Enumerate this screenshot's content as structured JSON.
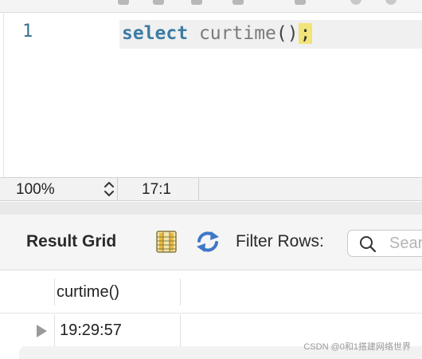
{
  "editor": {
    "line_number": "1",
    "code": {
      "keyword": "select",
      "function": "curtime",
      "parens": "()",
      "terminator": ";"
    }
  },
  "status_bar": {
    "zoom": "100%",
    "cursor_position": "17:1"
  },
  "result_panel": {
    "title": "Result Grid",
    "filter_label": "Filter Rows:",
    "search_placeholder": "Sear",
    "columns": [
      "curtime()"
    ],
    "rows": [
      [
        "19:29:57"
      ]
    ]
  },
  "watermark": "CSDN @0和1搭建网络世界",
  "icons": [
    "grid-view-icon",
    "refresh-icon",
    "search-icon",
    "row-pointer-icon",
    "stepper-icon"
  ],
  "colors": {
    "keyword": "#3c7ba3",
    "line_number": "#3a6f8f",
    "terminator_highlight": "#f2e37a",
    "refresh_blue": "#3e78c9"
  }
}
